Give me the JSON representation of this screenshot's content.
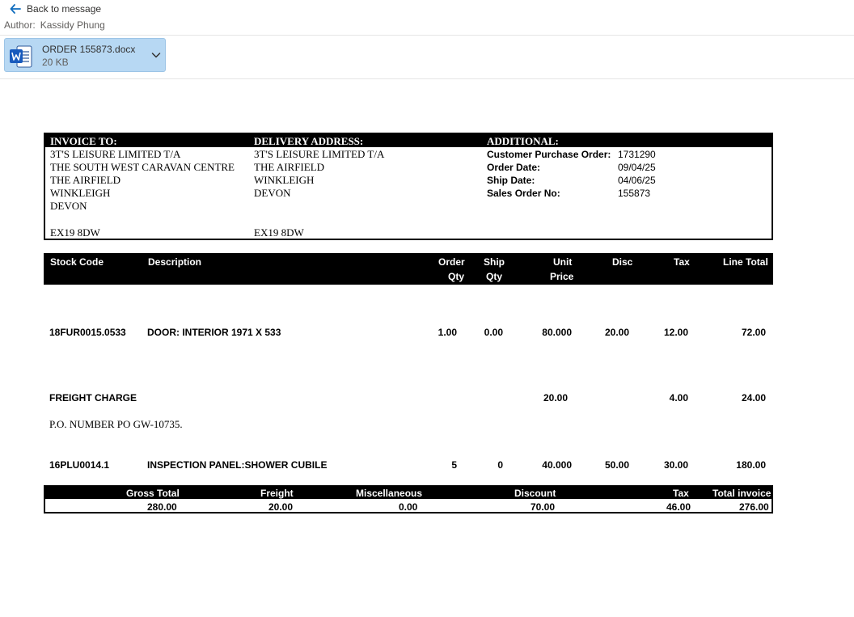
{
  "nav": {
    "back_label": "Back to message"
  },
  "author": {
    "label": "Author:",
    "name": "Kassidy Phung"
  },
  "attachment": {
    "file_name": "ORDER 155873.docx",
    "size": "20 KB",
    "icon": "word-icon"
  },
  "invoice_to": {
    "heading": "INVOICE TO:",
    "lines": [
      "3T'S LEISURE LIMITED T/A",
      "THE SOUTH WEST CARAVAN CENTRE",
      "THE AIRFIELD",
      "WINKLEIGH",
      "DEVON",
      "EX19 8DW"
    ]
  },
  "delivery": {
    "heading": "DELIVERY ADDRESS:",
    "lines": [
      "3T'S LEISURE LIMITED T/A",
      "THE AIRFIELD",
      "WINKLEIGH",
      "DEVON",
      "EX19 8DW"
    ]
  },
  "additional": {
    "heading": "ADDITIONAL:",
    "fields": [
      {
        "label": "Customer Purchase Order:",
        "value": "1731290"
      },
      {
        "label": "Order Date:",
        "value": "09/04/25"
      },
      {
        "label": "Ship Date:",
        "value": "04/06/25"
      },
      {
        "label": "Sales Order No:",
        "value": "155873"
      }
    ]
  },
  "items_header": {
    "stock_code": "Stock Code",
    "description": "Description",
    "order_qty": [
      "Order",
      "Qty"
    ],
    "ship_qty": [
      "Ship",
      "Qty"
    ],
    "unit_price": [
      "Unit",
      "Price"
    ],
    "disc": "Disc",
    "tax": "Tax",
    "line_total": "Line Total"
  },
  "items": [
    {
      "stock_code": "18FUR0015.0533",
      "description": "DOOR: INTERIOR 1971 X 533",
      "order_qty": "1.00",
      "ship_qty": "0.00",
      "unit_price": "80.000",
      "disc": "20.00",
      "tax": "12.00",
      "line_total": "72.00"
    },
    {
      "stock_code": "FREIGHT CHARGE",
      "description": "",
      "order_qty": "",
      "ship_qty": "",
      "unit_price": "20.00",
      "disc": "",
      "tax": "4.00",
      "line_total": "24.00"
    },
    {
      "stock_code": "16PLU0014.1",
      "description": "INSPECTION PANEL:SHOWER CUBILE",
      "order_qty": "5",
      "ship_qty": "0",
      "unit_price": "40.000",
      "disc": "50.00",
      "tax": "30.00",
      "line_total": "180.00"
    }
  ],
  "note": "P.O. NUMBER PO GW-10735.",
  "totals": {
    "headers": [
      "Gross Total",
      "Freight",
      "Miscellaneous",
      "Discount",
      "Tax",
      "Total invoice"
    ],
    "values": [
      "280.00",
      "20.00",
      "0.00",
      "70.00",
      "46.00",
      "276.00"
    ]
  }
}
